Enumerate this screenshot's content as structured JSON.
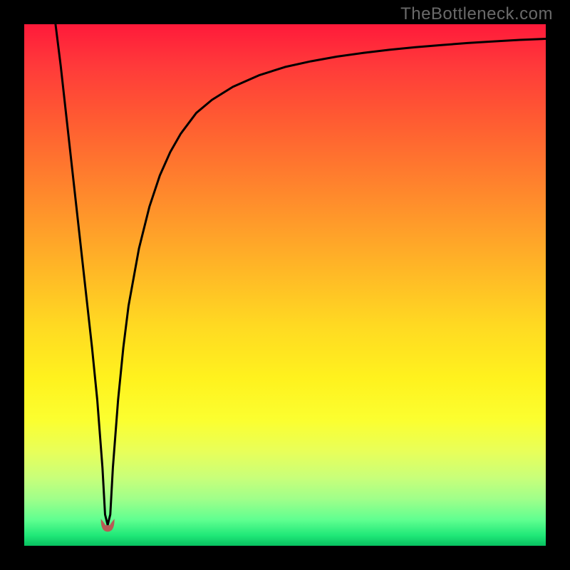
{
  "watermark": "TheBottleneck.com",
  "colors": {
    "frame": "#000000",
    "curve": "#000000",
    "marker": "#b85a55",
    "gradient_top": "#ff1a3a",
    "gradient_bottom": "#08c060"
  },
  "chart_data": {
    "type": "line",
    "title": "",
    "xlabel": "",
    "ylabel": "",
    "xlim": [
      0,
      100
    ],
    "ylim": [
      0,
      100
    ],
    "series": [
      {
        "name": "curve",
        "x": [
          6,
          7,
          8,
          9,
          10,
          11,
          12,
          13,
          14,
          15,
          15.5,
          16,
          16.5,
          17,
          18,
          19,
          20,
          22,
          24,
          26,
          28,
          30,
          33,
          36,
          40,
          45,
          50,
          55,
          60,
          65,
          70,
          75,
          80,
          85,
          90,
          95,
          100
        ],
        "values": [
          100,
          92,
          83,
          74,
          65,
          56,
          47,
          38,
          28,
          15,
          6,
          4,
          6,
          15,
          28,
          38,
          46,
          57,
          65,
          71,
          75.5,
          79,
          83,
          85.5,
          88,
          90.2,
          91.8,
          92.9,
          93.8,
          94.5,
          95.1,
          95.6,
          96,
          96.4,
          96.7,
          97,
          97.2
        ]
      }
    ],
    "marker": {
      "x": 16,
      "y": 4
    }
  }
}
